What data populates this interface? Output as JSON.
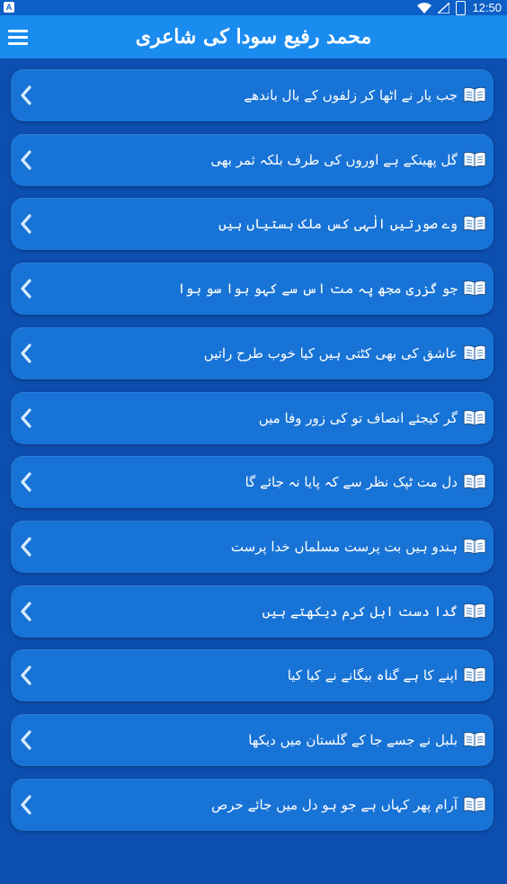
{
  "status_bar": {
    "left_badge": "A",
    "battery_level": "41",
    "time": "12:50"
  },
  "app_bar": {
    "title": "محمد رفیع سودا کی شاعری",
    "menu_icon": "hamburger-menu-icon"
  },
  "items": [
    {
      "label": "جب یار نے اٹھا کر زلفوں کے بال باندھے"
    },
    {
      "label": "گل پھینکے ہے اوروں کی طرف بلکہ ثمر بھی"
    },
    {
      "label": "وے صورتیں الٰہی کس ملک بستیاں ہیں"
    },
    {
      "label": "جو گزری مجھ پہ مت اس سے کہو ہوا سو ہوا"
    },
    {
      "label": "عاشق کی بھی کٹتی ہیں کیا خوب طرح راتیں"
    },
    {
      "label": "گر کیجئے انصاف تو کی زور وفا میں"
    },
    {
      "label": "دل مت ٹپک نظر سے کہ پایا نہ جائے گا"
    },
    {
      "label": "ہندو ہیں بت پرست مسلماں خدا پرست"
    },
    {
      "label": "گدا دست اہل کرم دیکھتے ہیں"
    },
    {
      "label": "اپنے کا ہے گناہ بیگانے نے کیا کیا"
    },
    {
      "label": "بلبل نے جسے جا کے گلستان میں دیکھا"
    },
    {
      "label": "آرام پھر کہاں ہے جو ہو دل میں جائے حرص"
    }
  ],
  "icons": {
    "item_leading": "open-book-icon",
    "item_trailing": "chevron-left-icon"
  },
  "colors": {
    "background": "#0d4fb0",
    "app_bar": "#1a8cf0",
    "item": "#1873d6",
    "text": "#ffffff"
  }
}
